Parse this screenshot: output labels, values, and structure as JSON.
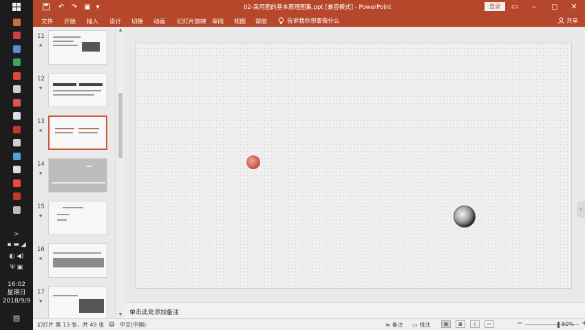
{
  "taskbar": {
    "start_icon": "windows-logo-icon",
    "apps": [
      {
        "name": "file-explorer-icon",
        "color": "#cf6d3a"
      },
      {
        "name": "app-icon",
        "color": "#d23c3c"
      },
      {
        "name": "app-icon",
        "color": "#5a8fd6"
      },
      {
        "name": "app-icon",
        "color": "#3aa35c"
      },
      {
        "name": "app-icon",
        "color": "#e04a3a"
      },
      {
        "name": "app-icon",
        "color": "#cfcfcf"
      },
      {
        "name": "app-icon",
        "color": "#d9534f"
      },
      {
        "name": "app-icon",
        "color": "#e0e0e0"
      },
      {
        "name": "app-icon",
        "color": "#c0392b"
      },
      {
        "name": "app-icon",
        "color": "#cfcfcf"
      },
      {
        "name": "app-icon",
        "color": "#4fa3d8"
      },
      {
        "name": "app-icon",
        "color": "#dddddd"
      },
      {
        "name": "app-icon",
        "color": "#e74c3c"
      },
      {
        "name": "app-icon",
        "color": "#c0392b"
      },
      {
        "name": "app-icon",
        "color": "#bbbbbb"
      }
    ],
    "clock": {
      "time": "16:02",
      "weekday": "星期日",
      "date": "2018/9/9"
    }
  },
  "titlebar": {
    "title": "02-采用图的基本原理图集.ppt [兼容模式] - PowerPoint",
    "login_label": "登录",
    "accent": "#b7472a"
  },
  "ribbon": {
    "tabs": [
      "文件",
      "开始",
      "插入",
      "设计",
      "切换",
      "动画",
      "幻灯片放映",
      "审阅",
      "视图",
      "帮助"
    ],
    "tell_me": "告诉我你想要做什么",
    "share": "共享"
  },
  "slides": [
    {
      "num": "11",
      "star": "★"
    },
    {
      "num": "12",
      "star": "★"
    },
    {
      "num": "13",
      "star": "★"
    },
    {
      "num": "14",
      "star": "★"
    },
    {
      "num": "15",
      "star": "★"
    },
    {
      "num": "16",
      "star": "★"
    },
    {
      "num": "17",
      "star": "★"
    }
  ],
  "selected_slide": "13",
  "notes": {
    "placeholder": "单击此处添加备注"
  },
  "statusbar": {
    "slide_info": "幻灯片 第 13 张，共 49 张",
    "language": "中文(中国)",
    "notes_btn": "备注",
    "comments_btn": "批注",
    "zoom": "80%"
  }
}
